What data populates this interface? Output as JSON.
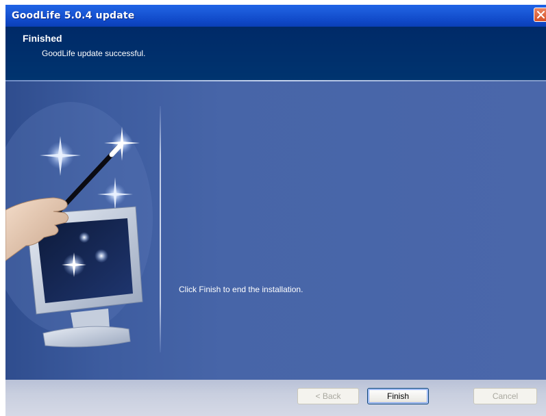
{
  "window": {
    "title": "GoodLife 5.0.4 update"
  },
  "header": {
    "title": "Finished",
    "subtitle": "GoodLife update successful."
  },
  "content": {
    "message": "Click Finish to end the installation."
  },
  "buttons": {
    "back": "< Back",
    "finish": "Finish",
    "cancel": "Cancel"
  },
  "icons": {
    "close": "close-icon",
    "illustration": "wizard-wand-monitor-illustration"
  }
}
